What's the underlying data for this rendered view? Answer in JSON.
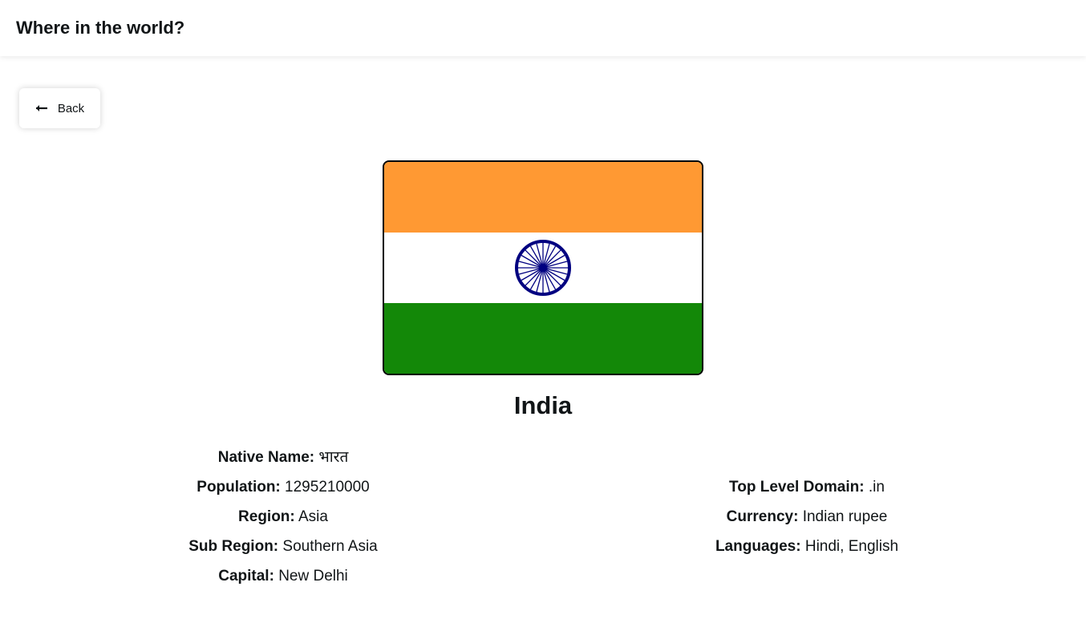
{
  "header": {
    "title": "Where in the world?"
  },
  "back_button": {
    "label": "Back"
  },
  "country": {
    "name": "India",
    "flag": {
      "colors": {
        "saffron": "#FF9933",
        "white": "#FFFFFF",
        "green": "#138808",
        "chakra": "#000080"
      }
    }
  },
  "details": {
    "native_name": {
      "label": "Native Name:",
      "value": "भारत"
    },
    "population": {
      "label": "Population:",
      "value": "1295210000"
    },
    "region": {
      "label": "Region:",
      "value": "Asia"
    },
    "sub_region": {
      "label": "Sub Region:",
      "value": "Southern Asia"
    },
    "capital": {
      "label": "Capital:",
      "value": "New Delhi"
    },
    "top_level_domain": {
      "label": "Top Level Domain:",
      "value": ".in"
    },
    "currency": {
      "label": "Currency:",
      "value": "Indian rupee"
    },
    "languages": {
      "label": "Languages:",
      "value": "Hindi, English"
    }
  }
}
